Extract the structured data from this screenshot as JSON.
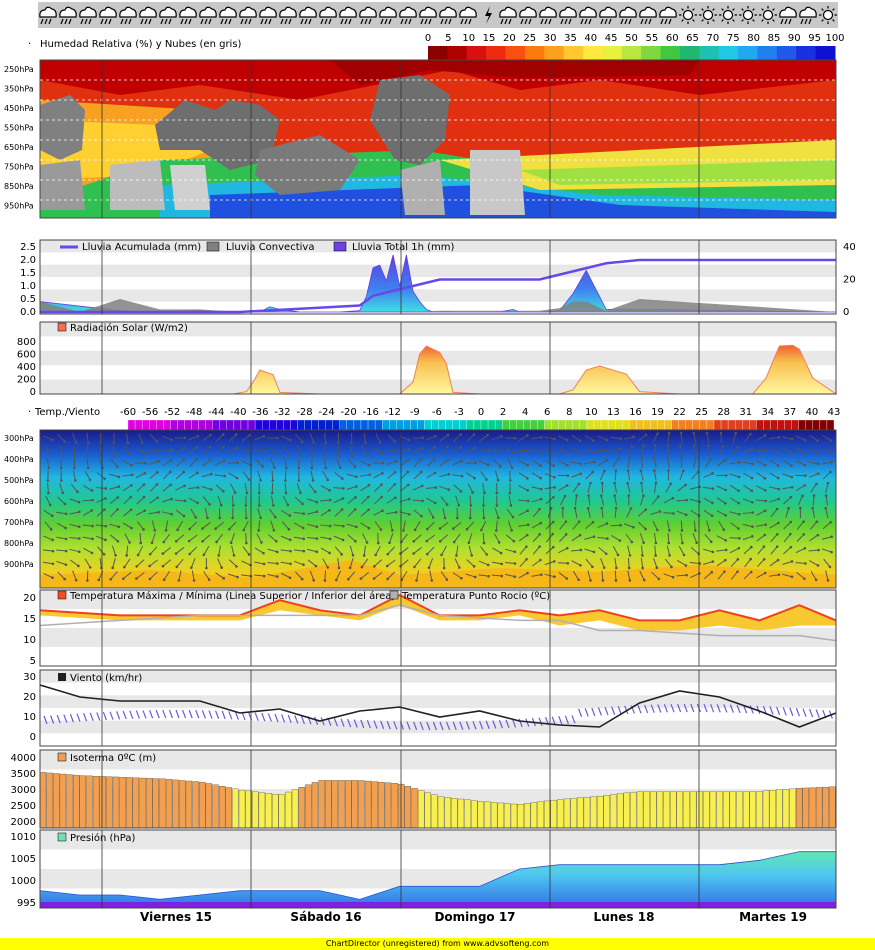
{
  "weather_icons": [
    "rain-cloud",
    "rain-cloud",
    "rain-cloud",
    "rain-cloud",
    "rain-cloud",
    "rain-cloud",
    "rain-cloud",
    "rain-cloud",
    "rain-cloud",
    "rain-cloud",
    "rain-cloud",
    "rain-cloud",
    "rain-cloud",
    "rain-cloud",
    "rain-cloud",
    "rain-cloud",
    "rain-cloud",
    "rain-cloud",
    "rain-cloud",
    "rain-cloud",
    "rain-cloud",
    "rain-cloud",
    "lightning",
    "rain-cloud",
    "rain-cloud",
    "rain-cloud",
    "rain-cloud",
    "rain-cloud",
    "rain-cloud",
    "rain-cloud",
    "rain-cloud",
    "rain-cloud",
    "sun",
    "sun",
    "sun",
    "sun",
    "sun",
    "rain-cloud",
    "rain-cloud",
    "sun"
  ],
  "humidity": {
    "title": "Humedad Relativa (%) y Nubes (en gris)",
    "scale_labels": [
      "0",
      "5",
      "10",
      "15",
      "20",
      "25",
      "30",
      "35",
      "40",
      "45",
      "50",
      "55",
      "60",
      "65",
      "70",
      "75",
      "80",
      "85",
      "90",
      "95",
      "100"
    ],
    "scale_colors": [
      "#8b0000",
      "#b00000",
      "#d81010",
      "#ee2a10",
      "#f85010",
      "#fc7a10",
      "#fda020",
      "#ffc830",
      "#ffe840",
      "#e8f040",
      "#b8e840",
      "#80d840",
      "#40c840",
      "#20b870",
      "#20c0b0",
      "#20c8e8",
      "#20a8f0",
      "#2080f0",
      "#2058e8",
      "#1830e0",
      "#1010d0"
    ],
    "levels": [
      "250hPa",
      "350hPa",
      "450hPa",
      "550hPa",
      "650hPa",
      "750hPa",
      "850hPa",
      "950hPa"
    ]
  },
  "rain": {
    "legend": [
      "Lluvia Acumulada (mm)",
      "Lluvia Convectiva",
      "Lluvia Total 1h (mm)"
    ],
    "left_ticks": [
      "2.5",
      "2.0",
      "1.5",
      "1.0",
      "0.5",
      "0.0"
    ],
    "right_ticks": [
      "40",
      "20",
      "0"
    ]
  },
  "radiation": {
    "title": "Radiación Solar (W/m2)",
    "ticks": [
      "800",
      "600",
      "400",
      "200",
      "0"
    ]
  },
  "temp_wind": {
    "title": "Temp./Viento",
    "scale_labels": [
      "-60",
      "-56",
      "-52",
      "-48",
      "-44",
      "-40",
      "-36",
      "-32",
      "-28",
      "-24",
      "-20",
      "-16",
      "-12",
      "-9",
      "-6",
      "-3",
      "0",
      "2",
      "4",
      "6",
      "8",
      "10",
      "13",
      "16",
      "19",
      "22",
      "25",
      "28",
      "31",
      "34",
      "37",
      "40",
      "43"
    ],
    "levels": [
      "300hPa",
      "400hPa",
      "500hPa",
      "600hPa",
      "700hPa",
      "800hPa",
      "900hPa"
    ]
  },
  "temperature": {
    "legend": [
      "Temperatura Máxima / Mínima (Linea Superior / Inferior del área)",
      "Temperatura Punto Rocio (ºC)"
    ],
    "ticks": [
      "20",
      "15",
      "10",
      "5"
    ]
  },
  "wind": {
    "title": "Viento (km/hr)",
    "ticks": [
      "30",
      "20",
      "10",
      "0"
    ]
  },
  "isotherm": {
    "title": "Isoterma 0ºC (m)",
    "ticks": [
      "4000",
      "3500",
      "3000",
      "2500",
      "2000"
    ]
  },
  "pressure": {
    "title": "Presión (hPa)",
    "ticks": [
      "1010",
      "1005",
      "1000",
      "995"
    ]
  },
  "days": [
    "Viernes 15",
    "Sábado 16",
    "Domingo 17",
    "Lunes 18",
    "Martes 19"
  ],
  "footer": "ChartDirector (unregistered) from www.advsofteng.com",
  "chart_data": [
    {
      "type": "area",
      "title": "Lluvia Acumulada (mm) / Lluvia Convectiva / Lluvia Total 1h (mm)",
      "x_unit": "hour",
      "series": [
        {
          "name": "Lluvia Total 1h (mm)",
          "x": [
            0,
            24,
            30,
            36,
            48,
            54,
            60,
            63,
            66,
            69,
            72,
            78,
            84,
            90,
            96,
            98,
            100,
            102,
            104,
            106,
            108,
            110,
            112,
            114,
            116,
            118,
            120,
            122,
            124,
            126,
            128,
            130,
            132,
            134,
            136,
            138,
            140,
            142,
            144,
            150,
            156,
            160,
            164,
            170,
            180,
            239
          ],
          "values": [
            0.4,
            0.05,
            0,
            0,
            0.05,
            0,
            0,
            0,
            0,
            0.2,
            0.1,
            0,
            0,
            0,
            0.05,
            0.6,
            1.7,
            1.8,
            1.2,
            2.2,
            1.0,
            2.2,
            0.8,
            0.4,
            0.1,
            0,
            0,
            0.02,
            0,
            0,
            0,
            0,
            0,
            0,
            0,
            0,
            0.05,
            0.1,
            0,
            0,
            0.05,
            0.7,
            1.6,
            0.1,
            0.1,
            0
          ]
        },
        {
          "name": "Lluvia Convectiva",
          "x": [
            0,
            12,
            24,
            36,
            48,
            60,
            72,
            84,
            96,
            110,
            120,
            130,
            150,
            156,
            160,
            164,
            170,
            180,
            239
          ],
          "values": [
            0.4,
            0,
            0.5,
            0.1,
            0.1,
            0,
            0,
            0,
            0,
            0,
            0.05,
            0.05,
            0.05,
            0.15,
            0.4,
            0.4,
            0.05,
            0.5,
            0
          ]
        },
        {
          "name": "Lluvia Acumulada (mm)",
          "x": [
            0,
            60,
            96,
            100,
            110,
            120,
            130,
            150,
            160,
            170,
            180,
            200,
            239
          ],
          "values": [
            0,
            0,
            4,
            10,
            15,
            20,
            20,
            20,
            25,
            30,
            32,
            32,
            32
          ]
        }
      ],
      "ylim": [
        0,
        2.5
      ],
      "y2lim": [
        0,
        40
      ]
    },
    {
      "type": "area",
      "title": "Radiación Solar (W/m2)",
      "x_unit": "hour",
      "x": [
        0,
        12,
        24,
        36,
        48,
        58,
        62,
        64,
        66,
        70,
        72,
        84,
        96,
        108,
        112,
        114,
        116,
        118,
        120,
        122,
        124,
        132,
        144,
        156,
        160,
        164,
        168,
        176,
        180,
        192,
        204,
        214,
        218,
        222,
        226,
        228,
        232,
        239
      ],
      "values": [
        0,
        0,
        0,
        0,
        0,
        0,
        30,
        150,
        300,
        240,
        20,
        0,
        0,
        0,
        150,
        500,
        600,
        560,
        520,
        380,
        20,
        0,
        0,
        0,
        50,
        300,
        350,
        250,
        30,
        0,
        0,
        0,
        200,
        600,
        610,
        560,
        200,
        0
      ],
      "ylim": [
        0,
        900
      ]
    },
    {
      "type": "line",
      "title": "Temperatura Máxima / Mínima / Temperatura Punto Rocio (ºC)",
      "x_unit": "hour",
      "series": [
        {
          "name": "Temperatura Máxima",
          "x": [
            0,
            24,
            48,
            60,
            72,
            84,
            96,
            108,
            120,
            132,
            144,
            156,
            168,
            180,
            192,
            204,
            216,
            228,
            239
          ],
          "values": [
            16,
            15,
            15,
            15,
            18,
            16,
            15,
            19,
            15,
            15,
            16,
            15,
            16,
            14,
            14,
            16,
            14,
            17,
            14
          ]
        },
        {
          "name": "Temperatura Mínima",
          "x": [
            0,
            24,
            48,
            60,
            72,
            84,
            96,
            108,
            120,
            132,
            144,
            156,
            168,
            180,
            192,
            204,
            216,
            228,
            239
          ],
          "values": [
            15,
            14,
            14,
            14,
            16,
            15,
            14,
            17,
            14,
            14,
            15,
            13,
            14,
            12,
            12,
            13,
            12,
            13,
            13
          ]
        },
        {
          "name": "Temperatura Punto Rocio (ºC)",
          "x": [
            0,
            24,
            48,
            72,
            96,
            108,
            120,
            144,
            156,
            168,
            180,
            204,
            228,
            239
          ],
          "values": [
            13,
            14,
            15,
            15,
            15,
            17,
            15,
            14,
            14,
            12,
            12,
            11,
            11,
            10
          ]
        }
      ],
      "ylim": [
        5,
        20
      ]
    },
    {
      "type": "line",
      "title": "Viento (km/hr)",
      "x_unit": "hour",
      "series": [
        {
          "name": "Viento (km/hr)",
          "x": [
            0,
            12,
            24,
            48,
            60,
            72,
            84,
            96,
            108,
            120,
            132,
            144,
            156,
            168,
            180,
            192,
            204,
            216,
            228,
            239
          ],
          "values": [
            26,
            20,
            18,
            18,
            12,
            14,
            8,
            13,
            15,
            10,
            13,
            8,
            6,
            5,
            17,
            23,
            20,
            13,
            5,
            12
          ]
        }
      ],
      "ylim": [
        0,
        30
      ]
    },
    {
      "type": "bar",
      "title": "Isoterma 0ºC (m)",
      "x_unit": "hour",
      "x": [
        0,
        12,
        24,
        36,
        48,
        60,
        72,
        84,
        96,
        108,
        120,
        132,
        144,
        156,
        168,
        180,
        192,
        204,
        216,
        228,
        239
      ],
      "values": [
        3550,
        3450,
        3400,
        3350,
        3250,
        3000,
        2850,
        3300,
        3300,
        3200,
        2800,
        2650,
        2550,
        2700,
        2800,
        2950,
        2950,
        2950,
        2950,
        3050,
        3100
      ],
      "ylim": [
        2000,
        4000
      ]
    },
    {
      "type": "area",
      "title": "Presión (hPa)",
      "x_unit": "hour",
      "x": [
        0,
        12,
        24,
        36,
        48,
        60,
        72,
        84,
        96,
        108,
        120,
        132,
        144,
        156,
        168,
        180,
        192,
        204,
        216,
        228,
        239
      ],
      "values": [
        998,
        997,
        997,
        996,
        997,
        998,
        998,
        998,
        996,
        999,
        999,
        999,
        1003,
        1004,
        1004,
        1004,
        1004,
        1004,
        1005,
        1007,
        1007
      ],
      "ylim": [
        994,
        1012
      ]
    }
  ]
}
